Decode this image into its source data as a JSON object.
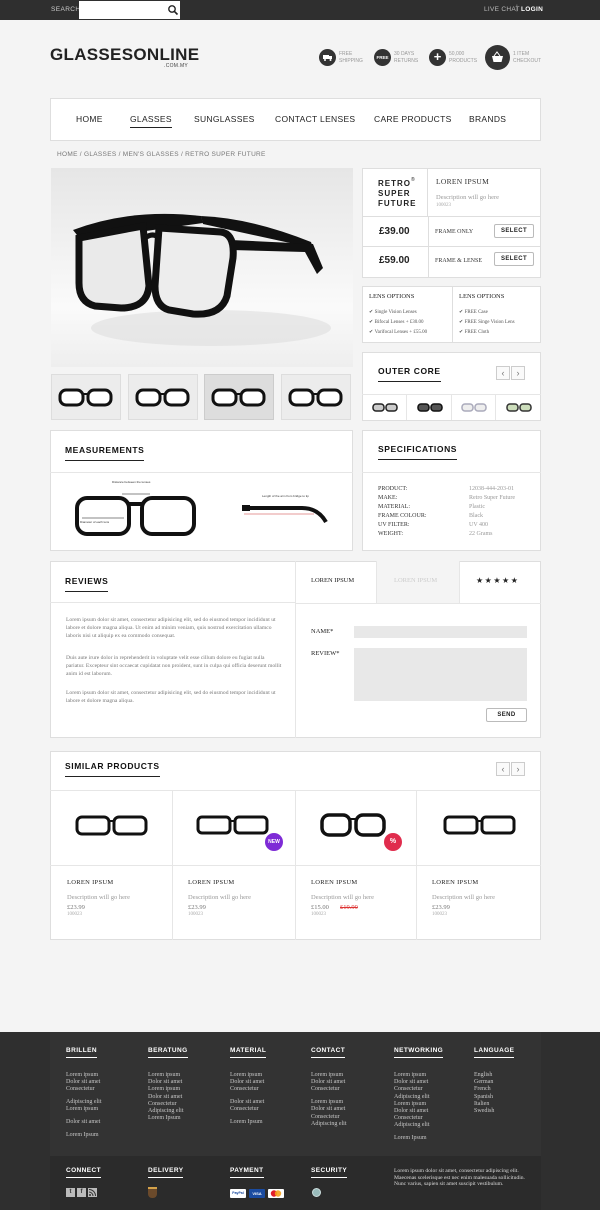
{
  "topbar": {
    "search_label": "SEARCH",
    "live_chat": "LIVE CHAT",
    "separator": "|",
    "login": "LOGIN"
  },
  "brand": {
    "name": "GLASSESONLINE",
    "domain": ".COM.MY"
  },
  "features": [
    {
      "icon": "truck-icon",
      "text1": "FREE",
      "text2": "SHIPPING"
    },
    {
      "icon": "free-badge-icon",
      "badge": "FREE",
      "text1": "30 DAYS",
      "text2": "RETURNS"
    },
    {
      "icon": "plus-icon",
      "text1": "50,000",
      "text2": "PRODUCTS"
    },
    {
      "icon": "basket-icon",
      "text1": "1 ITEM",
      "text2": "CHECKOUT"
    }
  ],
  "nav": [
    "HOME",
    "GLASSES",
    "SUNGLASSES",
    "CONTACT LENSES",
    "CARE PRODUCTS",
    "BRANDS"
  ],
  "breadcrumb": "HOME / GLASSES / MEN'S GLASSES / RETRO SUPER FUTURE",
  "product": {
    "brand_lines": [
      "RETRO",
      "SUPER",
      "FUTURE"
    ],
    "brand_mark": "®",
    "title": "LOREN IPSUM",
    "desc": "Description will go here",
    "code": "100023",
    "prices": [
      {
        "price": "£39.00",
        "label": "FRAME ONLY",
        "button": "SELECT"
      },
      {
        "price": "£59.00",
        "label": "FRAME & LENSE",
        "button": "SELECT"
      }
    ]
  },
  "lens_options": [
    {
      "title": "LENS OPTIONS",
      "items": [
        "Single Vision Lenses",
        "Bifocal Lenses + £30.00",
        "Varifocal Lenses + £55.00"
      ]
    },
    {
      "title": "LENS OPTIONS",
      "items": [
        "FREE Case",
        "FREE Singe Vision Lens",
        "FREE Cloth"
      ]
    }
  ],
  "outer_core": {
    "title": "OUTER CORE",
    "prev": "‹",
    "next": "›"
  },
  "measurements": {
    "title": "MEASUREMENTS",
    "label_a": "Distance between the lenses",
    "label_b": "Diameter of each lens",
    "label_c": "Length of the arm from bridge to tip"
  },
  "specifications": {
    "title": "SPECIFICATIONS",
    "rows": [
      {
        "k": "PRODUCT:",
        "v": "12038-444-203-01"
      },
      {
        "k": "MAKE:",
        "v": "Retro Super Future"
      },
      {
        "k": "MATERIAL:",
        "v": "Plastic"
      },
      {
        "k": "FRAME COLOUR:",
        "v": "Black"
      },
      {
        "k": "UV FILTER:",
        "v": "UV 400"
      },
      {
        "k": "WEIGHT:",
        "v": "22 Grams"
      }
    ]
  },
  "reviews": {
    "title": "REVIEWS",
    "tab1": "LOREN IPSUM",
    "tab2": "LOREN IPSUM",
    "stars": "★★★★★",
    "p1": "Lorem ipsum dolor sit amet, consectetur adipisicing elit, sed do eiusmod tempor incididunt ut labore et dolore magna aliqua. Ut enim ad minim veniam, quis nostrud exercitation ullamco laboris nisi ut aliquip ex ea commodo consequat.",
    "p2": "Duis aute irure dolor in reprehenderit in voluptate velit esse cillum dolore eu fugiat nulla pariatur. Excepteur sint occaecat cupidatat non proident, sunt in culpa qui officia deserunt mollit anim id est laborum.",
    "p3": "Lorem ipsum dolor sit amet, consectetur adipisicing elit, sed do eiusmod tempor incididunt ut labore et dolore magna aliqua.",
    "name_label": "NAME*",
    "review_label": "REVIEW*",
    "send": "SEND"
  },
  "similar": {
    "title": "SIMILAR PRODUCTS",
    "prev": "‹",
    "next": "›",
    "items": [
      {
        "title": "LOREN IPSUM",
        "desc": "Description will go here",
        "price": "£23.99",
        "old": "",
        "code": "100023",
        "badge": ""
      },
      {
        "title": "LOREN IPSUM",
        "desc": "Description will go here",
        "price": "£23.99",
        "old": "",
        "code": "100023",
        "badge": "NEW"
      },
      {
        "title": "LOREN IPSUM",
        "desc": "Description will go here",
        "price": "£15.00",
        "old": "£19.99",
        "code": "100023",
        "badge": "%"
      },
      {
        "title": "LOREN IPSUM",
        "desc": "Description will go here",
        "price": "£23.99",
        "old": "",
        "code": "100023",
        "badge": ""
      }
    ]
  },
  "footer": {
    "cols": [
      {
        "title": "BRILLEN",
        "groups": [
          [
            "Lorem ipsum",
            "Dolor sit amet",
            "Consectetur"
          ],
          [
            "Adipiscing elit",
            "Lorem ipsum"
          ],
          [
            "Dolor sit amet"
          ],
          [
            "Lorem Ipsum"
          ]
        ]
      },
      {
        "title": "BERATUNG",
        "groups": [
          [
            "Lorem ipsum",
            "Dolor sit amet",
            "Lorem ipsum",
            "Dolor sit amet",
            "Consectetur",
            "Adipiscing elit",
            "Lorem Ipsum"
          ]
        ]
      },
      {
        "title": "MATERIAL",
        "groups": [
          [
            "Lorem ipsum",
            "Dolor sit amet",
            "Consectetur"
          ],
          [
            "Dolor sit amet",
            "Consectetur"
          ],
          [
            "Lorem Ipsum"
          ]
        ]
      },
      {
        "title": "CONTACT",
        "groups": [
          [
            "Lorem ipsum",
            "Dolor sit amet",
            "Consectetur"
          ],
          [
            "Lorem ipsum",
            "Dolor sit amet",
            "Consectetur",
            "Adipiscing elit"
          ]
        ]
      },
      {
        "title": "NETWORKING",
        "groups": [
          [
            "Lorem ipsum",
            "Dolor sit amet",
            "Consectetur",
            "Adipiscing elit",
            "Lorem ipsum",
            "Dolor sit amet",
            "Consectetur",
            "Adipiscing elit"
          ],
          [
            "Lorem Ipsum"
          ]
        ]
      },
      {
        "title": "LANGUAGE",
        "groups": [
          [
            "English",
            "German",
            "French",
            "Spanish",
            "Italien",
            "Swedish"
          ]
        ]
      }
    ],
    "connect": "CONNECT",
    "delivery": "DELIVERY",
    "payment": "PAYMENT",
    "security": "SECURITY",
    "pay_visa": "VISA",
    "pay_paypal": "PayPal",
    "about": "Lorem ipsum dolor sit amet, consectetur adipiscing elit. Maecenas scelerisque est nec enim malesuada sollicitudin. Nunc varius, sapien sit amet suscipit vestibulum."
  }
}
